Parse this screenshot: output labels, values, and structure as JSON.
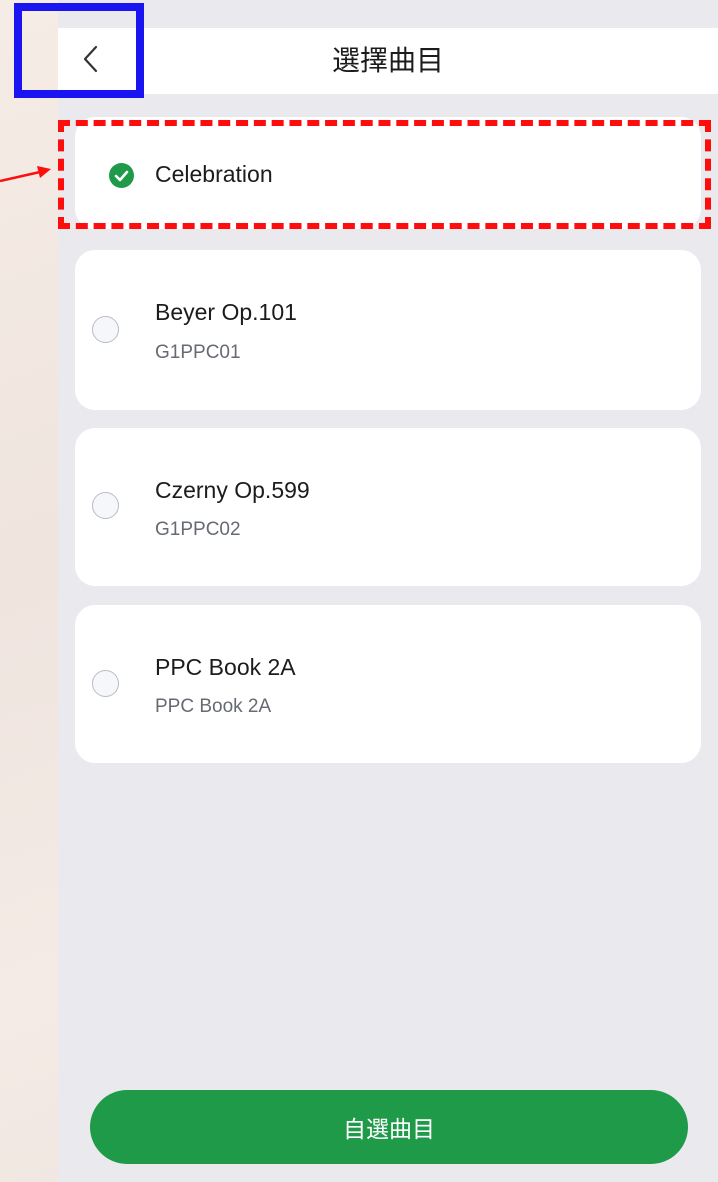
{
  "header": {
    "title": "選擇曲目"
  },
  "selected_item": {
    "label": "Celebration"
  },
  "items": [
    {
      "title": "Beyer Op.101",
      "subtitle": "G1PPC01"
    },
    {
      "title": "Czerny Op.599",
      "subtitle": "G1PPC02"
    },
    {
      "title": "PPC Book 2A",
      "subtitle": "PPC Book 2A"
    }
  ],
  "bottom_button": {
    "label": "自選曲目"
  },
  "icons": {
    "back": "chevron-left-icon",
    "selected": "check-circle-icon",
    "unselected": "radio-empty-icon"
  },
  "colors": {
    "accent_green": "#1f9a48",
    "annotation_blue": "#1a14f0",
    "annotation_red": "#ff0d0d"
  }
}
